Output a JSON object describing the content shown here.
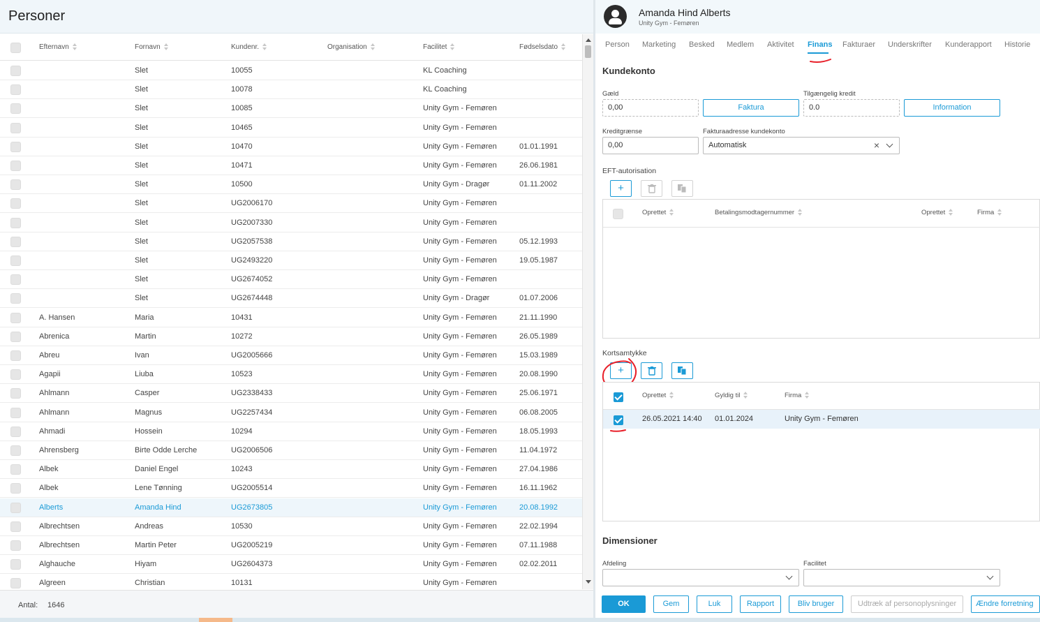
{
  "left": {
    "title": "Personer",
    "columns": [
      "Efternavn",
      "Fornavn",
      "Kundenr.",
      "Organisation",
      "Facilitet",
      "Fødselsdato"
    ],
    "rows": [
      {
        "efternavn": "",
        "fornavn": "Slet",
        "kundenr": "10055",
        "organisation": "",
        "facilitet": "KL Coaching",
        "fodselsdato": ""
      },
      {
        "efternavn": "",
        "fornavn": "Slet",
        "kundenr": "10078",
        "organisation": "",
        "facilitet": "KL Coaching",
        "fodselsdato": ""
      },
      {
        "efternavn": "",
        "fornavn": "Slet",
        "kundenr": "10085",
        "organisation": "",
        "facilitet": "Unity Gym - Femøren",
        "fodselsdato": ""
      },
      {
        "efternavn": "",
        "fornavn": "Slet",
        "kundenr": "10465",
        "organisation": "",
        "facilitet": "Unity Gym - Femøren",
        "fodselsdato": ""
      },
      {
        "efternavn": "",
        "fornavn": "Slet",
        "kundenr": "10470",
        "organisation": "",
        "facilitet": "Unity Gym - Femøren",
        "fodselsdato": "01.01.1991"
      },
      {
        "efternavn": "",
        "fornavn": "Slet",
        "kundenr": "10471",
        "organisation": "",
        "facilitet": "Unity Gym - Femøren",
        "fodselsdato": "26.06.1981"
      },
      {
        "efternavn": "",
        "fornavn": "Slet",
        "kundenr": "10500",
        "organisation": "",
        "facilitet": "Unity Gym - Dragør",
        "fodselsdato": "01.11.2002"
      },
      {
        "efternavn": "",
        "fornavn": "Slet",
        "kundenr": "UG2006170",
        "organisation": "",
        "facilitet": "Unity Gym - Femøren",
        "fodselsdato": ""
      },
      {
        "efternavn": "",
        "fornavn": "Slet",
        "kundenr": "UG2007330",
        "organisation": "",
        "facilitet": "Unity Gym - Femøren",
        "fodselsdato": ""
      },
      {
        "efternavn": "",
        "fornavn": "Slet",
        "kundenr": "UG2057538",
        "organisation": "",
        "facilitet": "Unity Gym - Femøren",
        "fodselsdato": "05.12.1993"
      },
      {
        "efternavn": "",
        "fornavn": "Slet",
        "kundenr": "UG2493220",
        "organisation": "",
        "facilitet": "Unity Gym - Femøren",
        "fodselsdato": "19.05.1987"
      },
      {
        "efternavn": "",
        "fornavn": "Slet",
        "kundenr": "UG2674052",
        "organisation": "",
        "facilitet": "Unity Gym - Femøren",
        "fodselsdato": ""
      },
      {
        "efternavn": "",
        "fornavn": "Slet",
        "kundenr": "UG2674448",
        "organisation": "",
        "facilitet": "Unity Gym - Dragør",
        "fodselsdato": "01.07.2006"
      },
      {
        "efternavn": "A. Hansen",
        "fornavn": "Maria",
        "kundenr": "10431",
        "organisation": "",
        "facilitet": "Unity Gym - Femøren",
        "fodselsdato": "21.11.1990"
      },
      {
        "efternavn": "Abrenica",
        "fornavn": "Martin",
        "kundenr": "10272",
        "organisation": "",
        "facilitet": "Unity Gym - Femøren",
        "fodselsdato": "26.05.1989"
      },
      {
        "efternavn": "Abreu",
        "fornavn": "Ivan",
        "kundenr": "UG2005666",
        "organisation": "",
        "facilitet": "Unity Gym - Femøren",
        "fodselsdato": "15.03.1989"
      },
      {
        "efternavn": "Agapii",
        "fornavn": "Liuba",
        "kundenr": "10523",
        "organisation": "",
        "facilitet": "Unity Gym - Femøren",
        "fodselsdato": "20.08.1990"
      },
      {
        "efternavn": "Ahlmann",
        "fornavn": "Casper",
        "kundenr": "UG2338433",
        "organisation": "",
        "facilitet": "Unity Gym - Femøren",
        "fodselsdato": "25.06.1971"
      },
      {
        "efternavn": "Ahlmann",
        "fornavn": "Magnus",
        "kundenr": "UG2257434",
        "organisation": "",
        "facilitet": "Unity Gym - Femøren",
        "fodselsdato": "06.08.2005"
      },
      {
        "efternavn": "Ahmadi",
        "fornavn": "Hossein",
        "kundenr": "10294",
        "organisation": "",
        "facilitet": "Unity Gym - Femøren",
        "fodselsdato": "18.05.1993"
      },
      {
        "efternavn": "Ahrensberg",
        "fornavn": "Birte Odde Lerche",
        "kundenr": "UG2006506",
        "organisation": "",
        "facilitet": "Unity Gym - Femøren",
        "fodselsdato": "11.04.1972"
      },
      {
        "efternavn": "Albek",
        "fornavn": "Daniel Engel",
        "kundenr": "10243",
        "organisation": "",
        "facilitet": "Unity Gym - Femøren",
        "fodselsdato": "27.04.1986"
      },
      {
        "efternavn": "Albek",
        "fornavn": "Lene Tønning",
        "kundenr": "UG2005514",
        "organisation": "",
        "facilitet": "Unity Gym - Femøren",
        "fodselsdato": "16.11.1962"
      },
      {
        "efternavn": "Alberts",
        "fornavn": "Amanda Hind",
        "kundenr": "UG2673805",
        "organisation": "",
        "facilitet": "Unity Gym - Femøren",
        "fodselsdato": "20.08.1992",
        "selected": true
      },
      {
        "efternavn": "Albrechtsen",
        "fornavn": "Andreas",
        "kundenr": "10530",
        "organisation": "",
        "facilitet": "Unity Gym - Femøren",
        "fodselsdato": "22.02.1994"
      },
      {
        "efternavn": "Albrechtsen",
        "fornavn": "Martin Peter",
        "kundenr": "UG2005219",
        "organisation": "",
        "facilitet": "Unity Gym - Femøren",
        "fodselsdato": "07.11.1988"
      },
      {
        "efternavn": "Alghauche",
        "fornavn": "Hiyam",
        "kundenr": "UG2604373",
        "organisation": "",
        "facilitet": "Unity Gym - Femøren",
        "fodselsdato": "02.02.2011"
      },
      {
        "efternavn": "Algreen",
        "fornavn": "Christian",
        "kundenr": "10131",
        "organisation": "",
        "facilitet": "Unity Gym - Femøren",
        "fodselsdato": ""
      }
    ],
    "footer": {
      "count_label": "Antal:",
      "count_value": "1646"
    }
  },
  "right": {
    "name": "Amanda Hind Alberts",
    "subtitle": "Unity Gym - Femøren",
    "tabs": [
      "Person",
      "Marketing",
      "Besked",
      "Medlem",
      "Aktivitet",
      "Finans",
      "Fakturaer",
      "Underskrifter",
      "Kunderapport",
      "Historie"
    ],
    "active_tab": "Finans",
    "kundekonto": {
      "title": "Kundekonto",
      "gaeld_label": "Gæld",
      "gaeld_value": "0,00",
      "faktura_button": "Faktura",
      "tilgaengelig_label": "Tilgængelig kredit",
      "tilgaengelig_value": "0.0",
      "information_button": "Information",
      "kreditgraense_label": "Kreditgrænse",
      "kreditgraense_value": "0,00",
      "fakturaadresse_label": "Fakturaadresse kundekonto",
      "fakturaadresse_value": "Automatisk"
    },
    "eft": {
      "title": "EFT-autorisation",
      "columns": [
        "Oprettet",
        "Betalingsmodtagernummer",
        "Oprettet",
        "Firma"
      ]
    },
    "kortsamtykke": {
      "title": "Kortsamtykke",
      "columns": [
        "Oprettet",
        "Gyldig til",
        "Firma"
      ],
      "rows": [
        {
          "oprettet": "26.05.2021 14:40",
          "gyldig_til": "01.01.2024",
          "firma": "Unity Gym - Femøren"
        }
      ]
    },
    "dimensioner": {
      "title": "Dimensioner",
      "afdeling_label": "Afdeling",
      "afdeling_value": "",
      "facilitet_label": "Facilitet",
      "facilitet_value": ""
    },
    "actions": {
      "ok": "OK",
      "gem": "Gem",
      "luk": "Luk",
      "rapport": "Rapport",
      "bliv_bruger": "Bliv bruger",
      "udtraek": "Udtræk af personoplysninger",
      "aendre": "Ændre forretning"
    }
  },
  "colors": {
    "accent": "#1a9ad6",
    "annotation": "#e8202a"
  }
}
